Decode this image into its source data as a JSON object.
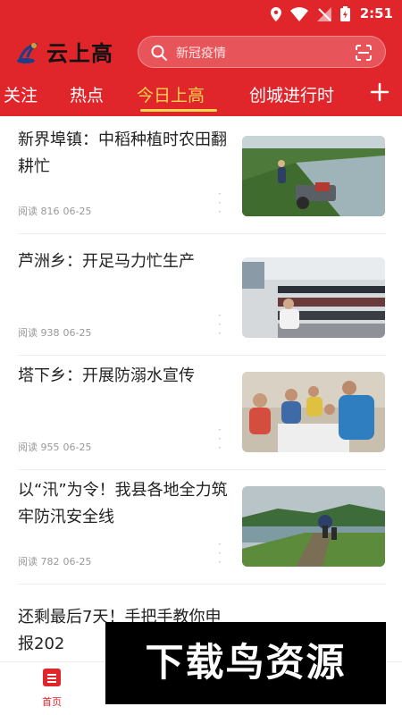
{
  "status": {
    "time": "2:51"
  },
  "app": {
    "name": "云上高"
  },
  "search": {
    "placeholder": "新冠疫情"
  },
  "tabs": [
    {
      "label": "关注"
    },
    {
      "label": "热点"
    },
    {
      "label": "今日上高",
      "active": true
    },
    {
      "label": "创城进行时"
    }
  ],
  "articles": [
    {
      "title": "新界埠镇：中稻种植时农田翻耕忙",
      "reads": "阅读 816",
      "date": "06-25"
    },
    {
      "title": "芦洲乡：开足马力忙生产",
      "reads": "阅读 938",
      "date": "06-25"
    },
    {
      "title": "塔下乡：开展防溺水宣传",
      "reads": "阅读 955",
      "date": "06-25"
    },
    {
      "title": "以“汛”为令！我县各地全力筑牢防汛安全线",
      "reads": "阅读 782",
      "date": "06-25"
    },
    {
      "title": "还剩最后7天！手把手教你申报202"
    }
  ],
  "bottom_nav": {
    "home_label": "首页"
  },
  "watermark": "下载鸟资源",
  "colors": {
    "brand": "#e0252b",
    "active_tab": "#ffd54f"
  }
}
